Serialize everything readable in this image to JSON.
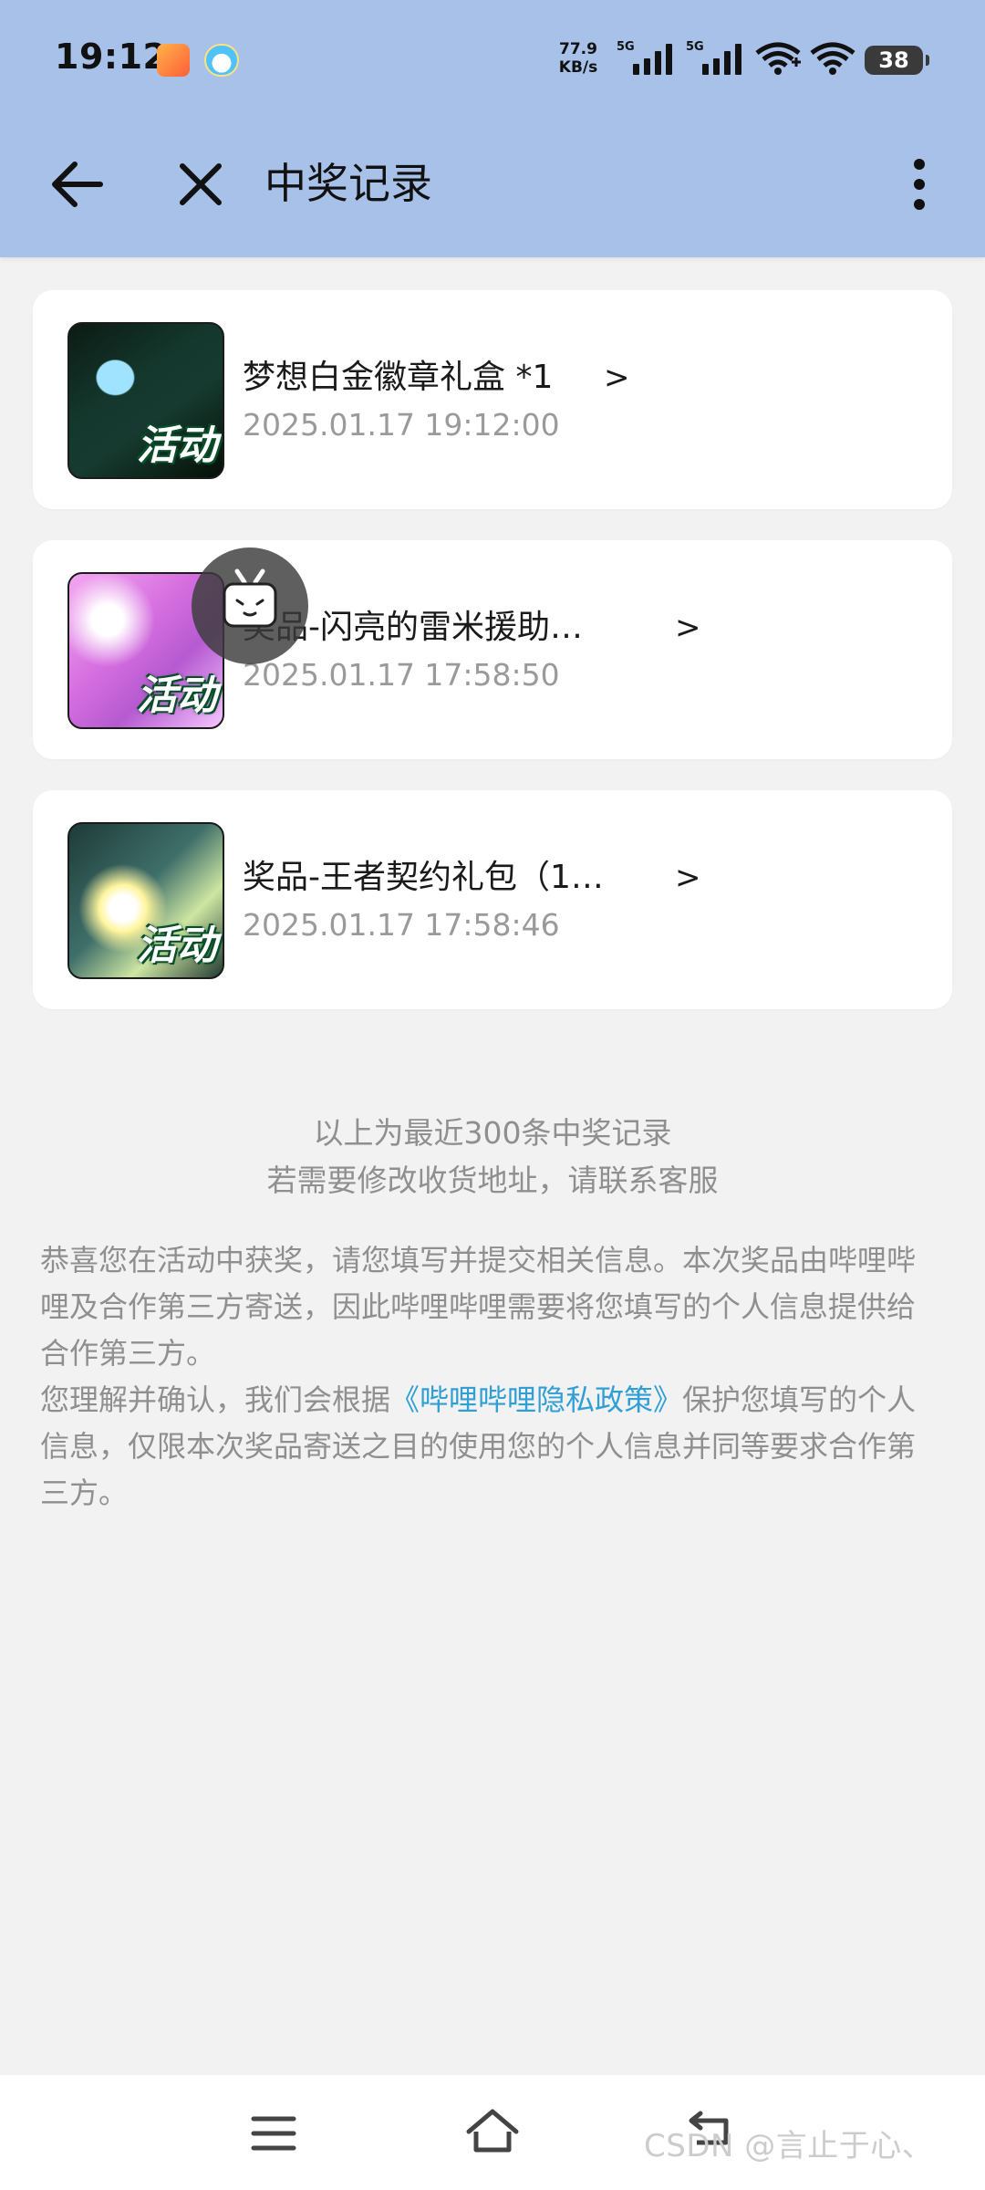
{
  "status_bar": {
    "time": "19:12",
    "net_speed_value": "77.9",
    "net_speed_unit": "KB/s",
    "signal_1_label": "5G",
    "signal_2_label": "5G",
    "battery": "38"
  },
  "header": {
    "title": "中奖记录"
  },
  "prizes": [
    {
      "name": "梦想白金徽章礼盒 *1",
      "arrow": ">",
      "time": "2025.01.17 19:12:00",
      "badge": "活动"
    },
    {
      "name": "奖品-闪亮的雷米援助…",
      "arrow": ">",
      "time": "2025.01.17 17:58:50",
      "badge": "活动"
    },
    {
      "name": "奖品-王者契约礼包（1…",
      "arrow": ">",
      "time": "2025.01.17 17:58:46",
      "badge": "活动"
    }
  ],
  "info": {
    "line1": "以上为最近300条中奖记录",
    "line2": "若需要修改收货地址，请联系客服"
  },
  "notice": {
    "para1": "恭喜您在活动中获奖，请您填写并提交相关信息。本次奖品由哔哩哔哩及合作第三方寄送，因此哔哩哔哩需要将您填写的个人信息提供给合作第三方。",
    "para2_prefix": "您理解并确认，我们会根据",
    "para2_link": "《哔哩哔哩隐私政策》",
    "para2_suffix": "保护您填写的个人信息，仅限本次奖品寄送之目的使用您的个人信息并同等要求合作第三方。"
  },
  "watermark": "CSDN @言止于心、",
  "colors": {
    "header_bg": "#a7c1e8",
    "page_bg": "#f2f2f2",
    "link": "#2f9fd6",
    "muted_text": "#8f8f8f"
  },
  "icons": {
    "back": "arrow-left-icon",
    "close": "close-icon",
    "more": "more-vertical-icon",
    "float": "bilibili-tv-icon",
    "nav_menu": "menu-icon",
    "nav_home": "home-icon",
    "nav_back": "back-icon"
  }
}
